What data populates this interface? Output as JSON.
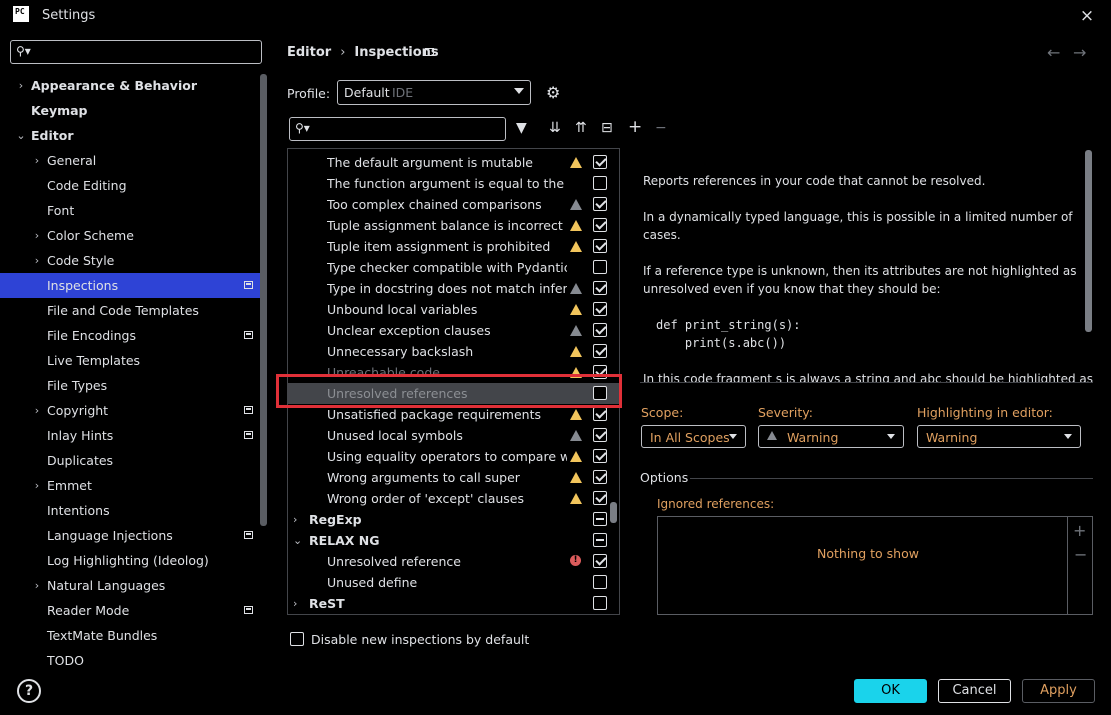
{
  "window": {
    "title": "Settings",
    "logo_text": "PC",
    "close_icon": "×"
  },
  "sidebar": {
    "search_placeholder": "",
    "items": [
      {
        "label": "Appearance & Behavior",
        "bold": true,
        "arrow": "›",
        "level": 0
      },
      {
        "label": "Keymap",
        "bold": true,
        "arrow": "",
        "level": 0
      },
      {
        "label": "Editor",
        "bold": true,
        "arrow": "⌄",
        "level": 0
      },
      {
        "label": "General",
        "arrow": "›",
        "level": 1
      },
      {
        "label": "Code Editing",
        "arrow": "",
        "level": 1
      },
      {
        "label": "Font",
        "arrow": "",
        "level": 1
      },
      {
        "label": "Color Scheme",
        "arrow": "›",
        "level": 1
      },
      {
        "label": "Code Style",
        "arrow": "›",
        "level": 1
      },
      {
        "label": "Inspections",
        "arrow": "",
        "level": 1,
        "selected": true,
        "project": true
      },
      {
        "label": "File and Code Templates",
        "arrow": "",
        "level": 1
      },
      {
        "label": "File Encodings",
        "arrow": "",
        "level": 1,
        "project": true
      },
      {
        "label": "Live Templates",
        "arrow": "",
        "level": 1
      },
      {
        "label": "File Types",
        "arrow": "",
        "level": 1
      },
      {
        "label": "Copyright",
        "arrow": "›",
        "level": 1,
        "project": true
      },
      {
        "label": "Inlay Hints",
        "arrow": "",
        "level": 1,
        "project": true
      },
      {
        "label": "Duplicates",
        "arrow": "",
        "level": 1
      },
      {
        "label": "Emmet",
        "arrow": "›",
        "level": 1
      },
      {
        "label": "Intentions",
        "arrow": "",
        "level": 1
      },
      {
        "label": "Language Injections",
        "arrow": "",
        "level": 1,
        "project": true
      },
      {
        "label": "Log Highlighting (Ideolog)",
        "arrow": "",
        "level": 1
      },
      {
        "label": "Natural Languages",
        "arrow": "›",
        "level": 1
      },
      {
        "label": "Reader Mode",
        "arrow": "",
        "level": 1,
        "project": true
      },
      {
        "label": "TextMate Bundles",
        "arrow": "",
        "level": 1
      },
      {
        "label": "TODO",
        "arrow": "",
        "level": 1
      }
    ]
  },
  "header": {
    "crumb_1": "Editor",
    "crumb_sep": "›",
    "crumb_2": "Inspections",
    "back_icon": "←",
    "forward_icon": "→"
  },
  "profile": {
    "label": "Profile:",
    "value": "Default",
    "sub": "IDE"
  },
  "toolbar": {
    "filter": "▼",
    "expand": "⇊",
    "collapse": "⇈",
    "reset": "⊟",
    "add": "+",
    "remove": "−"
  },
  "inspections": [
    {
      "label": "The default argument is mutable",
      "sev": "warn",
      "check": "checked"
    },
    {
      "label": "The function argument is equal to the default",
      "sev": "",
      "check": "unchecked"
    },
    {
      "label": "Too complex chained comparisons",
      "sev": "weak",
      "check": "checked"
    },
    {
      "label": "Tuple assignment balance is incorrect",
      "sev": "warn",
      "check": "checked"
    },
    {
      "label": "Tuple item assignment is prohibited",
      "sev": "warn",
      "check": "checked"
    },
    {
      "label": "Type checker compatible with Pydantic",
      "sev": "",
      "check": "unchecked"
    },
    {
      "label": "Type in docstring does not match inferred type",
      "sev": "weak",
      "check": "checked"
    },
    {
      "label": "Unbound local variables",
      "sev": "warn",
      "check": "checked"
    },
    {
      "label": "Unclear exception clauses",
      "sev": "weak",
      "check": "checked"
    },
    {
      "label": "Unnecessary backslash",
      "sev": "warn",
      "check": "checked"
    },
    {
      "label": "Unreachable code",
      "sev": "warn",
      "check": "checked",
      "faded": true
    },
    {
      "label": "Unresolved references",
      "sev": "",
      "check": "unchecked",
      "highlight": true
    },
    {
      "label": "Unsatisfied package requirements",
      "sev": "warn",
      "check": "checked"
    },
    {
      "label": "Unused local symbols",
      "sev": "weak",
      "check": "checked"
    },
    {
      "label": "Using equality operators to compare with None",
      "sev": "warn",
      "check": "checked"
    },
    {
      "label": "Wrong arguments to call super",
      "sev": "warn",
      "check": "checked"
    },
    {
      "label": "Wrong order of 'except' clauses",
      "sev": "warn",
      "check": "checked"
    },
    {
      "label": "RegExp",
      "group": true,
      "arrow": "›",
      "check": "partial"
    },
    {
      "label": "RELAX NG",
      "group": true,
      "arrow": "⌄",
      "check": "partial"
    },
    {
      "label": "Unresolved reference",
      "sev": "err",
      "check": "checked"
    },
    {
      "label": "Unused define",
      "sev": "",
      "check": "unchecked"
    },
    {
      "label": "ReST",
      "group": true,
      "arrow": "›",
      "check": "unchecked"
    }
  ],
  "disable_new_label": "Disable new inspections by default",
  "description": {
    "p1": "Reports references in your code that cannot be resolved.",
    "p2": "In a dynamically typed language, this is possible in a limited number of cases.",
    "p3": "If a reference type is unknown, then its attributes are not highlighted as unresolved even if you know that they should be:",
    "code": "def print_string(s):\n    print(s.abc())",
    "cut": "In this code fragment s is always a string and abc should be highlighted as"
  },
  "settings": {
    "scope_label": "Scope:",
    "scope_value": "In All Scopes",
    "severity_label": "Severity:",
    "severity_value": "Warning",
    "highlight_label": "Highlighting in editor:",
    "highlight_value": "Warning"
  },
  "options": {
    "title": "Options",
    "ignored_label": "Ignored references:",
    "empty_text": "Nothing to show",
    "add_icon": "+",
    "remove_icon": "−"
  },
  "footer": {
    "help": "?",
    "ok": "OK",
    "cancel": "Cancel",
    "apply": "Apply"
  },
  "colors": {
    "accent": "#2e43d6",
    "ok_button": "#1ad3eb",
    "highlight_border": "#e03038",
    "warning": "#f2c55c",
    "error": "#db5c5c",
    "orange_text": "#e0a060"
  }
}
